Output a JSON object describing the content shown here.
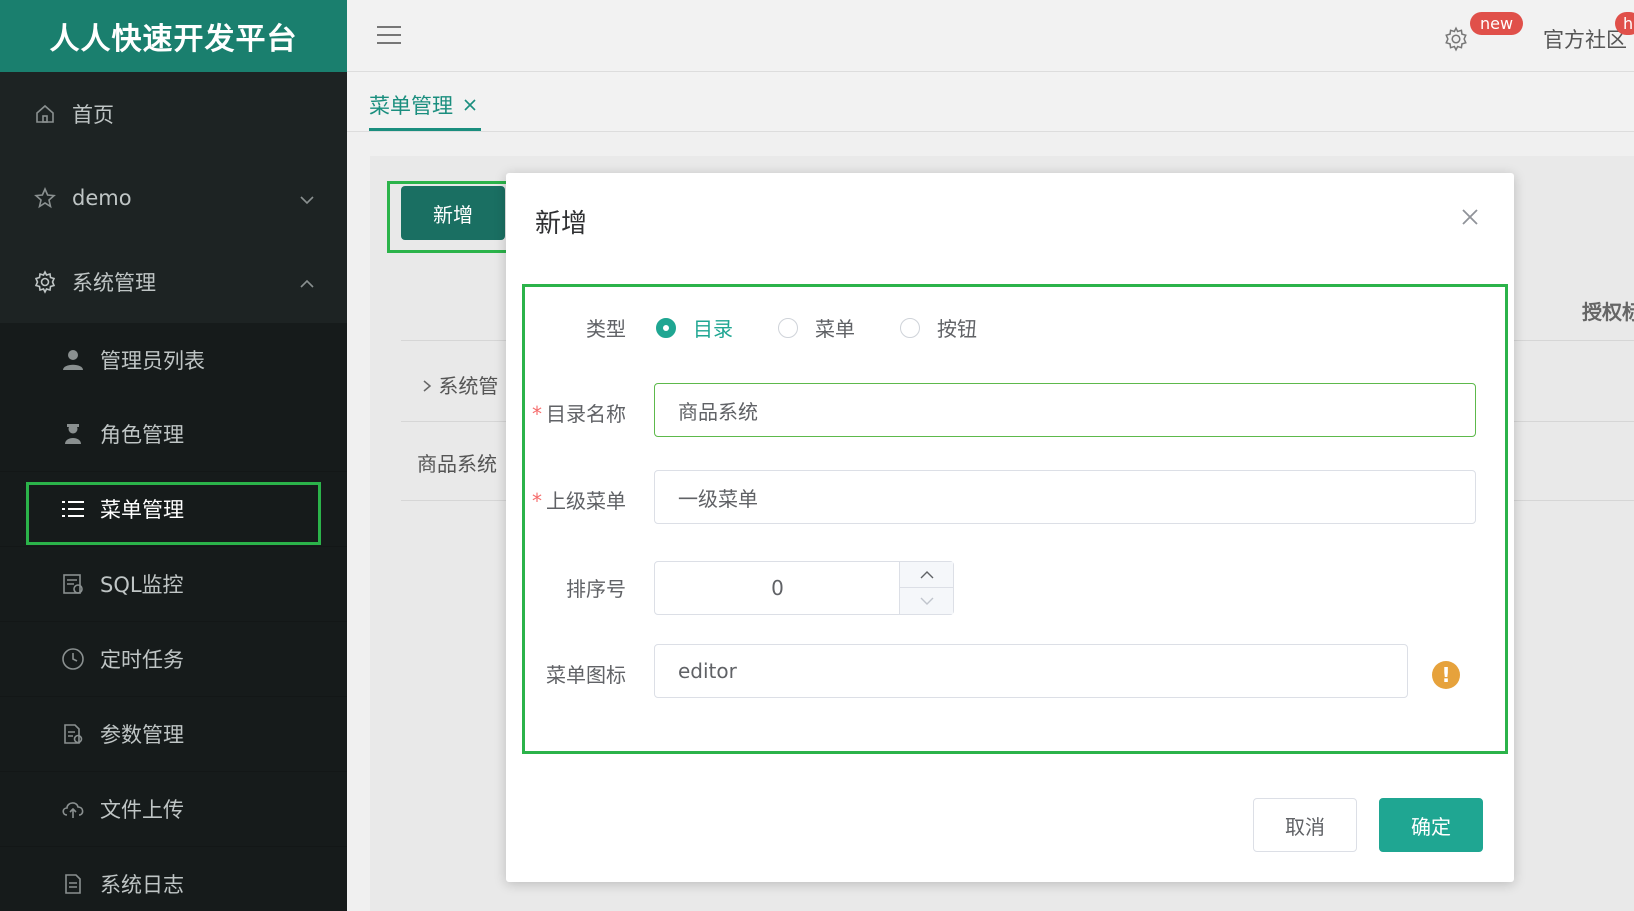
{
  "app": {
    "logo": "人人快速开发平台"
  },
  "header": {
    "new_badge": "new",
    "community": "官方社区",
    "h_badge": "h"
  },
  "sidebar": {
    "items": [
      {
        "label": "首页",
        "icon": "home-icon"
      },
      {
        "label": "demo",
        "icon": "star-icon"
      },
      {
        "label": "系统管理",
        "icon": "gear-icon"
      }
    ],
    "sub_items": [
      {
        "label": "管理员列表",
        "icon": "user-icon"
      },
      {
        "label": "角色管理",
        "icon": "role-icon"
      },
      {
        "label": "菜单管理",
        "icon": "list-icon"
      },
      {
        "label": "SQL监控",
        "icon": "monitor-icon"
      },
      {
        "label": "定时任务",
        "icon": "clock-icon"
      },
      {
        "label": "参数管理",
        "icon": "params-icon"
      },
      {
        "label": "文件上传",
        "icon": "cloud-upload-icon"
      },
      {
        "label": "系统日志",
        "icon": "log-icon"
      }
    ]
  },
  "tabs": [
    {
      "label": "菜单管理"
    }
  ],
  "content": {
    "add_button": "新增",
    "header_fragment": "授权标",
    "row1_fragment": "系统管",
    "row2_fragment": "商品系统"
  },
  "modal": {
    "title": "新增",
    "form": {
      "type_label": "类型",
      "type_options": [
        "目录",
        "菜单",
        "按钮"
      ],
      "type_selected": "目录",
      "name_label": "目录名称",
      "name_value": "商品系统",
      "parent_label": "上级菜单",
      "parent_value": "一级菜单",
      "order_label": "排序号",
      "order_value": "0",
      "icon_label": "菜单图标",
      "icon_value": "editor"
    },
    "cancel": "取消",
    "ok": "确定"
  },
  "colors": {
    "accent": "#1fa692",
    "logo_bg": "#1a7f6e",
    "sidebar_bg": "#1a1f1f",
    "annotation": "#2bb34a"
  }
}
